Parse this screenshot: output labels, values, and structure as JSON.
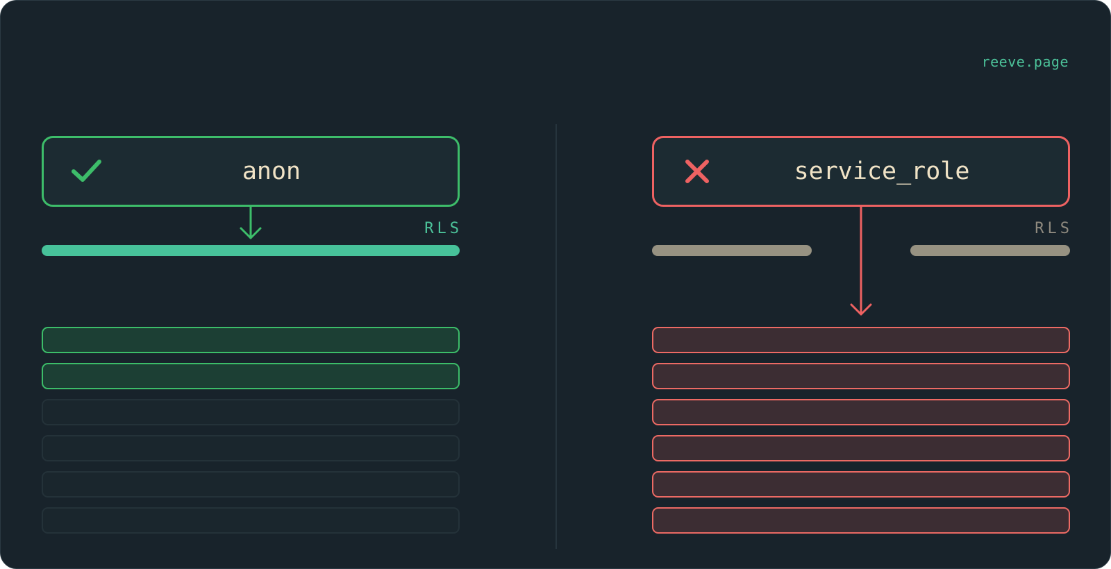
{
  "brand": "reeve.page",
  "colors": {
    "allowed": "#3dbd6a",
    "denied": "#ee6262",
    "rls_active": "#47c29a",
    "rls_bypassed": "#979282",
    "label_text": "#f0e3c6",
    "background": "#18232b"
  },
  "panels": {
    "left": {
      "role": "anon",
      "status_icon": "check-icon",
      "rls_label": "RLS",
      "rls_state": "enforced",
      "rows": [
        "granted",
        "granted",
        "hidden",
        "hidden",
        "hidden",
        "hidden"
      ]
    },
    "right": {
      "role": "service_role",
      "status_icon": "cross-icon",
      "rls_label": "RLS",
      "rls_state": "bypassed",
      "rows": [
        "exposed",
        "exposed",
        "exposed",
        "exposed",
        "exposed",
        "exposed"
      ]
    }
  }
}
